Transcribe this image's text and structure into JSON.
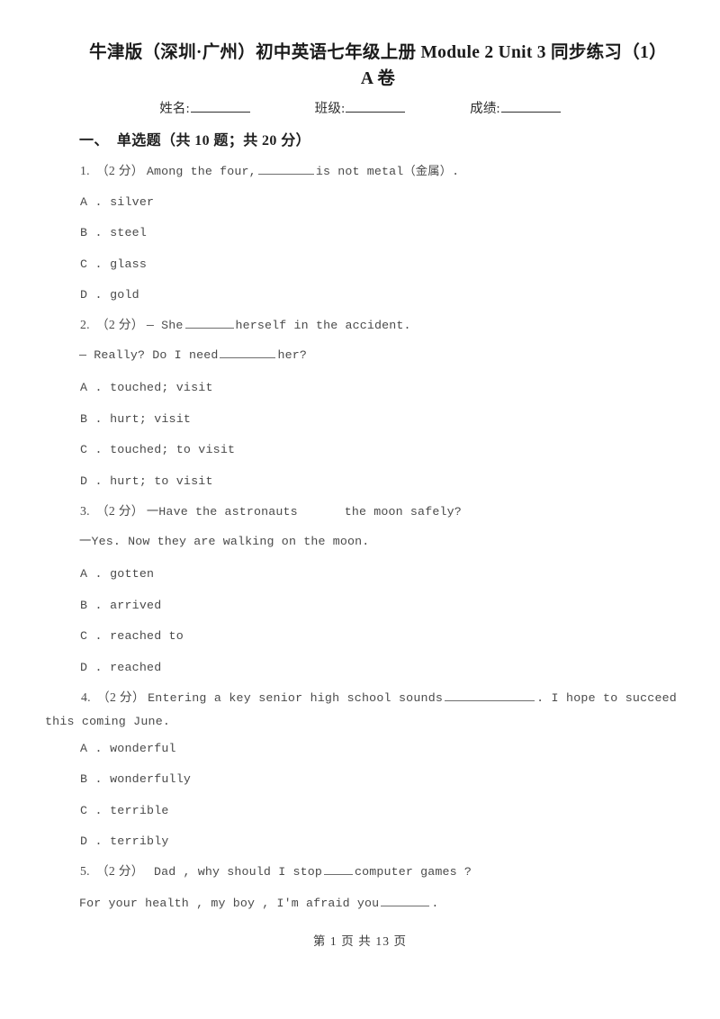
{
  "document": {
    "title": "牛津版（深圳·广州）初中英语七年级上册 Module 2 Unit 3 同步练习（1）A卷",
    "title_line1": "牛津版（深圳·广州）初中英语七年级上册 Module 2 Unit 3 同步练习（1）A",
    "title_line2": "卷"
  },
  "info_line": {
    "name_label": "姓名:",
    "class_label": "班级:",
    "score_label": "成绩:"
  },
  "section": {
    "number": "一、",
    "title": "单选题（共 10 题；共 20 分）"
  },
  "questions": [
    {
      "number": "1.",
      "score": "（2 分）",
      "stem_part1": "Among the four,",
      "stem_part2": "is not metal（金属）.",
      "options": [
        {
          "letter": "A .",
          "text": "silver"
        },
        {
          "letter": "B .",
          "text": "steel"
        },
        {
          "letter": "C .",
          "text": "glass"
        },
        {
          "letter": "D .",
          "text": "gold"
        }
      ]
    },
    {
      "number": "2.",
      "score": "（2 分）",
      "stem_part1": "— She",
      "stem_part2": "herself in the accident.",
      "sub_part1": "— Really?  Do I need",
      "sub_part2": "her?",
      "options": [
        {
          "letter": "A .",
          "text": "touched; visit"
        },
        {
          "letter": "B .",
          "text": "hurt; visit"
        },
        {
          "letter": "C .",
          "text": "touched; to visit"
        },
        {
          "letter": "D .",
          "text": "hurt; to visit"
        }
      ]
    },
    {
      "number": "3.",
      "score": "（2 分）",
      "stem_part1": "一Have the astronauts",
      "stem_part2": "the moon safely?",
      "sub_line": "一Yes. Now they are walking on the moon.",
      "options": [
        {
          "letter": "A .",
          "text": "gotten"
        },
        {
          "letter": "B .",
          "text": "arrived"
        },
        {
          "letter": "C .",
          "text": "reached to"
        },
        {
          "letter": "D .",
          "text": "reached"
        }
      ]
    },
    {
      "number": "4.",
      "score": "（2 分）",
      "stem_part1": "Entering a key senior high school sounds",
      "stem_part2": ". I hope to succeed this coming June.",
      "options": [
        {
          "letter": "A .",
          "text": "wonderful"
        },
        {
          "letter": "B .",
          "text": "wonderfully"
        },
        {
          "letter": "C .",
          "text": "terrible"
        },
        {
          "letter": "D .",
          "text": "terribly"
        }
      ]
    },
    {
      "number": "5.",
      "score": "（2 分）",
      "stem_part1": " Dad , why should I stop",
      "stem_part2": "computer games ?",
      "sub_part1": "For your health , my boy , I'm afraid you",
      "sub_part2": "."
    }
  ],
  "footer": {
    "text": "第 1 页 共 13 页"
  }
}
